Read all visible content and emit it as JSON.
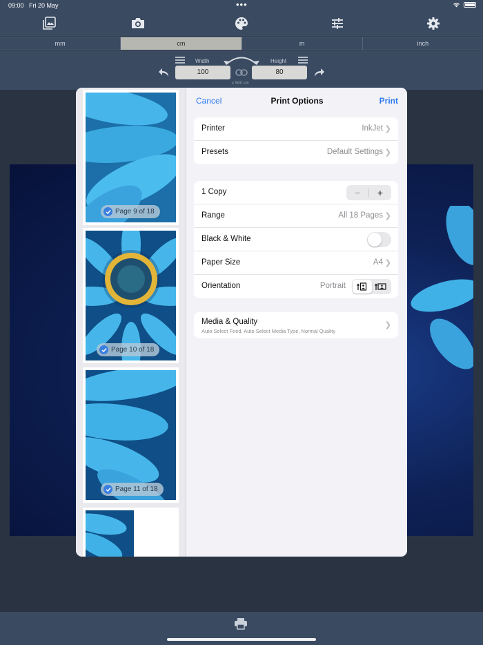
{
  "status_bar": {
    "time": "09:00",
    "date": "Fri 20 May",
    "dots": "•••"
  },
  "toolbar": {
    "icons": [
      "gallery-icon",
      "camera-icon",
      "palette-icon",
      "sliders-icon",
      "gear-icon"
    ]
  },
  "units": {
    "options": [
      "mm",
      "cm",
      "m",
      "inch"
    ],
    "selected": "cm"
  },
  "size": {
    "width_label": "Width",
    "width_value": "100",
    "height_label": "Height",
    "height_value": "80",
    "max_note": "≤ 500 cm"
  },
  "print_options": {
    "cancel": "Cancel",
    "title": "Print Options",
    "print": "Print",
    "printer": {
      "label": "Printer",
      "value": "InkJet"
    },
    "presets": {
      "label": "Presets",
      "value": "Default Settings"
    },
    "copies": {
      "label": "1 Copy",
      "minus": "−",
      "plus": "+"
    },
    "range": {
      "label": "Range",
      "value": "All 18 Pages"
    },
    "black_white": {
      "label": "Black & White",
      "on": false
    },
    "paper_size": {
      "label": "Paper Size",
      "value": "A4"
    },
    "orientation": {
      "label": "Orientation",
      "value": "Portrait"
    },
    "media_quality": {
      "label": "Media & Quality",
      "subtitle": "Auto Select Feed, Auto Select Media Type, Normal Quality"
    }
  },
  "thumbnails": [
    {
      "label": "Page 9 of 18"
    },
    {
      "label": "Page 10 of 18"
    },
    {
      "label": "Page 11 of 18"
    }
  ],
  "colors": {
    "accent": "#2f7bf0",
    "bar": "#3a4a61",
    "petal": "#3fb1e6",
    "selected_segment": "#b7b7b2"
  }
}
